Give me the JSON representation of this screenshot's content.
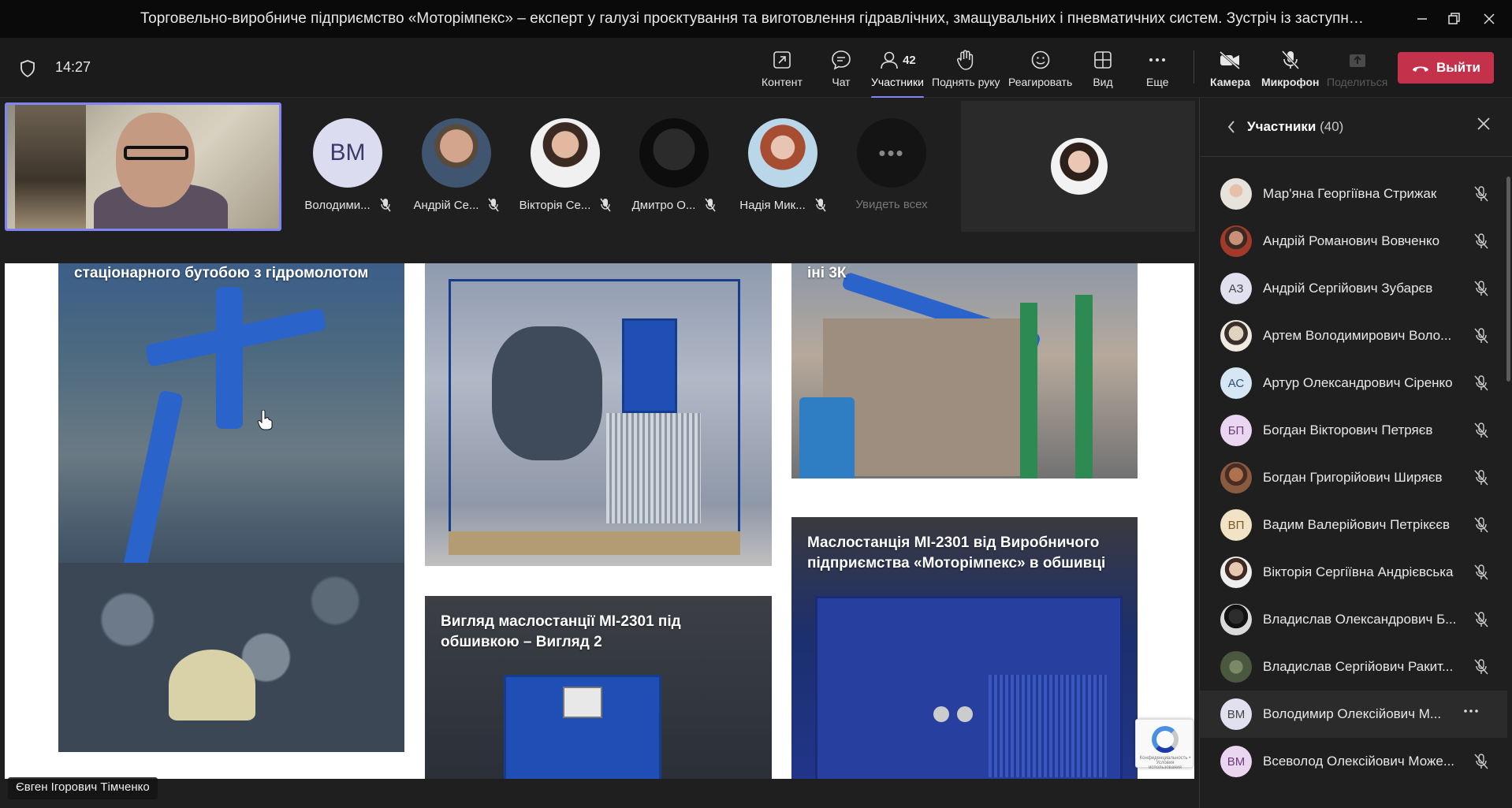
{
  "window": {
    "title": "Торговельно-виробниче підприємство «Моторімпекс» – експерт у галузі проєктування та виготовлення гідравлічних, змащувальних і пневматичних систем. Зустріч із заступником директора ..."
  },
  "meeting": {
    "time": "14:27"
  },
  "toolbar": {
    "content": "Контент",
    "chat": "Чат",
    "participants": "Участники",
    "participants_count": "42",
    "raise_hand": "Поднять руку",
    "react": "Реагировать",
    "view": "Вид",
    "more": "Еще",
    "camera": "Камера",
    "microphone": "Микрофон",
    "share": "Поделиться",
    "leave": "Выйти"
  },
  "gallery": [
    {
      "label": "Володими...",
      "initials": "ВМ"
    },
    {
      "label": "Андрій Се..."
    },
    {
      "label": "Вікторія Се..."
    },
    {
      "label": "Дмитро О..."
    },
    {
      "label": "Надія Мик..."
    }
  ],
  "see_all": {
    "label": "Увидеть всех",
    "dots": "•••"
  },
  "shared_content": {
    "caption_1": "стаціонарного бутобою з гідромолотом",
    "caption_3": "іні 3К",
    "caption_4": "Вигляд маслостанції МІ-2301 під обшивкою – Вигляд 2",
    "caption_5": "Маслостанція МІ-2301 від Виробничого підприємства «Моторімпекс» в обшивці",
    "recaptcha_text": "Конфиденциальность • Условия использования"
  },
  "presenter": {
    "name": "Євген Ігорович Тімченко"
  },
  "side_panel": {
    "title": "Участники",
    "count": "(40)",
    "participants": [
      {
        "name": "Мар'яна Георгіївна Стрижак"
      },
      {
        "name": "Андрій Романович Вовченко"
      },
      {
        "name": "Андрій Сергійович Зубарєв",
        "initials": "АЗ"
      },
      {
        "name": "Артем Володимирович Воло..."
      },
      {
        "name": "Артур Олександрович Сіренко",
        "initials": "АС"
      },
      {
        "name": "Богдан Вікторович Петряєв",
        "initials": "БП"
      },
      {
        "name": "Богдан Григорійович Ширяєв"
      },
      {
        "name": "Вадим Валерійович Петрікєєв",
        "initials": "ВП"
      },
      {
        "name": "Вікторія Сергіївна Андрієвська"
      },
      {
        "name": "Владислав Олександрович Б..."
      },
      {
        "name": "Владислав Сергійович Ракит..."
      },
      {
        "name": "Володимир Олексійович М...",
        "initials": "ВМ"
      },
      {
        "name": "Всеволод Олексійович Може...",
        "initials": "ВМ"
      }
    ]
  },
  "colors": {
    "accent": "#7f85f5",
    "leave": "#c4314b",
    "background": "#1f1f1f"
  }
}
